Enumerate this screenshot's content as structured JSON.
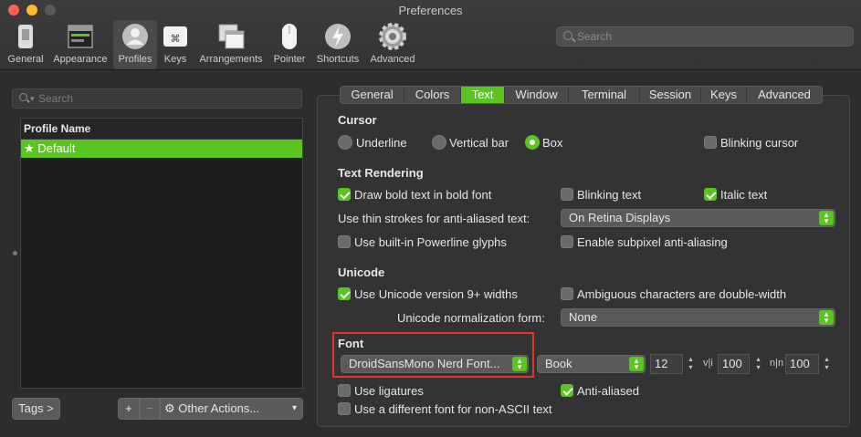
{
  "window": {
    "title": "Preferences"
  },
  "colors": {
    "accent": "#5ac521",
    "close": "#fe5f57",
    "minimize": "#febc2e",
    "zoom_disabled": "#5a5a5a",
    "highlight": "#e0372a"
  },
  "toolbar": {
    "items": [
      {
        "label": "General",
        "icon": "general-icon"
      },
      {
        "label": "Appearance",
        "icon": "appearance-icon"
      },
      {
        "label": "Profiles",
        "icon": "profiles-icon",
        "selected": true
      },
      {
        "label": "Keys",
        "icon": "keys-icon"
      },
      {
        "label": "Arrangements",
        "icon": "arrangements-icon"
      },
      {
        "label": "Pointer",
        "icon": "pointer-icon"
      },
      {
        "label": "Shortcuts",
        "icon": "shortcuts-icon"
      },
      {
        "label": "Advanced",
        "icon": "advanced-icon"
      }
    ],
    "search_placeholder": "Search"
  },
  "profiles": {
    "search_placeholder": "Search",
    "column_header": "Profile Name",
    "rows": [
      {
        "name": "Default",
        "default": true
      }
    ],
    "tags_button": "Tags >",
    "add_button": "+",
    "remove_button": "−",
    "other_actions": "Other Actions..."
  },
  "tabs": [
    "General",
    "Colors",
    "Text",
    "Window",
    "Terminal",
    "Session",
    "Keys",
    "Advanced"
  ],
  "active_tab": "Text",
  "cursor": {
    "title": "Cursor",
    "options": [
      "Underline",
      "Vertical bar",
      "Box"
    ],
    "selected": "Box",
    "blinking_label": "Blinking cursor",
    "blinking": false
  },
  "text_rendering": {
    "title": "Text Rendering",
    "bold_in_bold": {
      "label": "Draw bold text in bold font",
      "checked": true
    },
    "blinking_text": {
      "label": "Blinking text",
      "checked": false
    },
    "italic_text": {
      "label": "Italic text",
      "checked": true
    },
    "thin_strokes_label": "Use thin strokes for anti-aliased text:",
    "thin_strokes_value": "On Retina Displays",
    "powerline": {
      "label": "Use built-in Powerline glyphs",
      "checked": false
    },
    "subpixel": {
      "label": "Enable subpixel anti-aliasing",
      "checked": false
    }
  },
  "unicode": {
    "title": "Unicode",
    "version9": {
      "label": "Use Unicode version 9+ widths",
      "checked": true
    },
    "ambiguous": {
      "label": "Ambiguous characters are double-width",
      "checked": false
    },
    "normalization_label": "Unicode normalization form:",
    "normalization_value": "None"
  },
  "font": {
    "title": "Font",
    "family": "DroidSansMono Nerd Font...",
    "style": "Book",
    "size": "12",
    "vli_label": "v|i",
    "vertical_spacing": "100",
    "hspace_label": "n|n",
    "horizontal_spacing": "100",
    "ligatures": {
      "label": "Use ligatures",
      "checked": false
    },
    "anti_aliased": {
      "label": "Anti-aliased",
      "checked": true
    },
    "non_ascii": {
      "label": "Use a different font for non-ASCII text",
      "checked": false
    }
  }
}
